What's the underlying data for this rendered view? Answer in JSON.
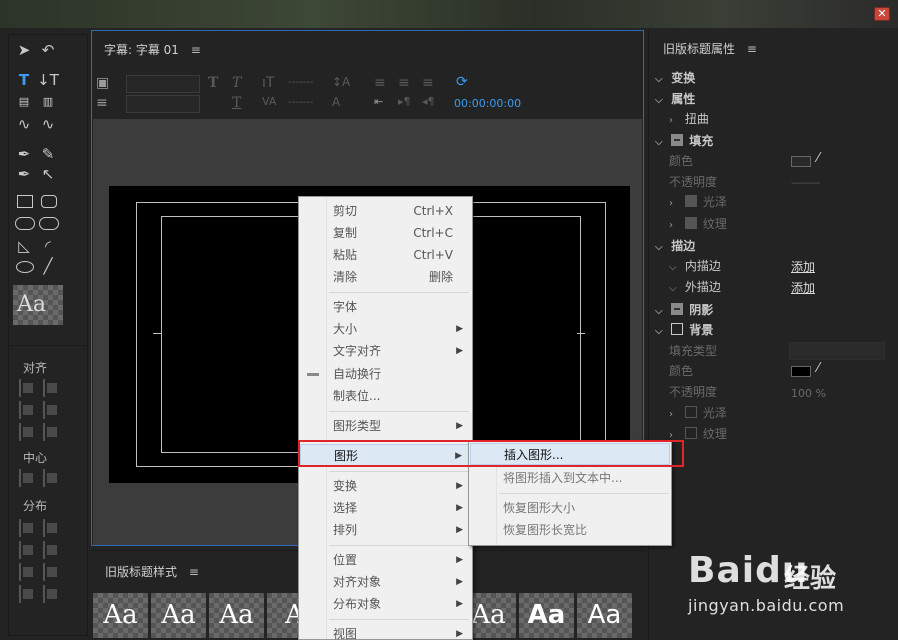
{
  "window": {
    "close_glyph": "✕"
  },
  "tools": {
    "align_label": "对齐",
    "center_label": "中心",
    "distribute_label": "分布",
    "sample_text": "Aa"
  },
  "title_panel": {
    "tab_title": "字幕: 字幕 01",
    "menu_icon": "≡",
    "timecode": "00:00:00:00"
  },
  "styles_panel": {
    "title": "旧版标题样式",
    "menu_icon": "≡",
    "swatches": [
      "Aa",
      "Aa",
      "Aa",
      "A",
      "Aa",
      "Aa",
      "Aa"
    ]
  },
  "props": {
    "title": "旧版标题属性",
    "menu_icon": "≡",
    "transform": "变换",
    "properties": "属性",
    "distort": "扭曲",
    "fill": "填充",
    "color": "颜色",
    "opacity": "不透明度",
    "gloss": "光泽",
    "texture": "纹理",
    "stroke": "描边",
    "inner_stroke": "内描边",
    "outer_stroke": "外描边",
    "add": "添加",
    "shadow": "阴影",
    "background": "背景",
    "fill_type": "填充类型",
    "bg_color": "颜色",
    "bg_opacity": "不透明度",
    "bg_opacity_value": "100 %",
    "bg_gloss": "光泽",
    "bg_texture": "纹理"
  },
  "context_menu": {
    "items": [
      {
        "label": "剪切",
        "shortcut": "Ctrl+X"
      },
      {
        "label": "复制",
        "shortcut": "Ctrl+C"
      },
      {
        "label": "粘贴",
        "shortcut": "Ctrl+V"
      },
      {
        "label": "清除",
        "shortcut": "删除"
      },
      {
        "label": "字体",
        "shortcut": ""
      },
      {
        "label": "大小",
        "shortcut": ""
      },
      {
        "label": "文字对齐",
        "shortcut": ""
      },
      {
        "label": "自动换行",
        "shortcut": ""
      },
      {
        "label": "制表位...",
        "shortcut": ""
      },
      {
        "label": "图形类型",
        "shortcut": ""
      },
      {
        "label": "图形",
        "shortcut": ""
      },
      {
        "label": "变换",
        "shortcut": ""
      },
      {
        "label": "选择",
        "shortcut": ""
      },
      {
        "label": "排列",
        "shortcut": ""
      },
      {
        "label": "位置",
        "shortcut": ""
      },
      {
        "label": "对齐对象",
        "shortcut": ""
      },
      {
        "label": "分布对象",
        "shortcut": ""
      },
      {
        "label": "视图",
        "shortcut": ""
      }
    ],
    "submenu_arrow": "▶"
  },
  "submenu": {
    "items": [
      {
        "label": "插入图形..."
      },
      {
        "label": "将图形插入到文本中..."
      },
      {
        "label": "恢复图形大小"
      },
      {
        "label": "恢复图形长宽比"
      }
    ]
  },
  "watermark": {
    "logo": "Bai",
    "logo_paw": "du",
    "cn": "经验",
    "url": "jingyan.baidu.com"
  }
}
